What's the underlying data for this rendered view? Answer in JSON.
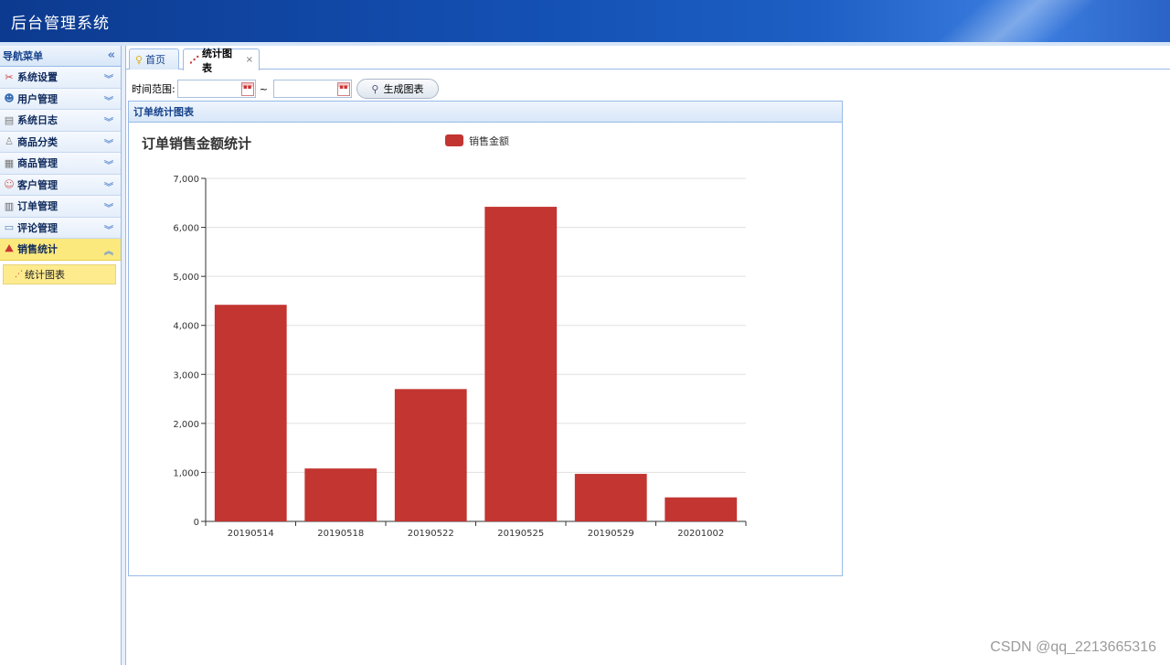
{
  "app": {
    "title": "后台管理系统"
  },
  "sidebar": {
    "header": "导航菜单",
    "items": [
      {
        "label": "系统设置",
        "icon": "tools-icon"
      },
      {
        "label": "用户管理",
        "icon": "users-icon"
      },
      {
        "label": "系统日志",
        "icon": "log-icon"
      },
      {
        "label": "商品分类",
        "icon": "category-icon"
      },
      {
        "label": "商品管理",
        "icon": "goods-icon"
      },
      {
        "label": "客户管理",
        "icon": "customer-icon"
      },
      {
        "label": "订单管理",
        "icon": "order-icon"
      },
      {
        "label": "评论管理",
        "icon": "comment-icon"
      },
      {
        "label": "销售统计",
        "icon": "stats-icon"
      }
    ],
    "active_sub": "统计图表"
  },
  "tabs": [
    {
      "label": "首页"
    },
    {
      "label": "统计图表"
    }
  ],
  "toolbar": {
    "range_label": "时间范围:",
    "tilde": "~",
    "start_value": "",
    "end_value": "",
    "generate_label": "生成图表"
  },
  "panel": {
    "title": "订单统计图表"
  },
  "chart_data": {
    "type": "bar",
    "title": "订单销售金额统计",
    "legend": [
      "销售金额"
    ],
    "legend_position": "top",
    "categories": [
      "20190514",
      "20190518",
      "20190522",
      "20190525",
      "20190529",
      "20201002"
    ],
    "series": [
      {
        "name": "销售金额",
        "values": [
          4420,
          1080,
          2700,
          6420,
          970,
          490
        ],
        "color": "#c23531"
      }
    ],
    "ylim": [
      0,
      7000
    ],
    "yticks": [
      "0",
      "1,000",
      "2,000",
      "3,000",
      "4,000",
      "5,000",
      "6,000",
      "7,000"
    ],
    "grid": true
  },
  "watermark": "CSDN @qq_2213665316",
  "colors": {
    "accent": "#1450b3",
    "bar": "#c23531",
    "active_menu": "#fce97d"
  }
}
